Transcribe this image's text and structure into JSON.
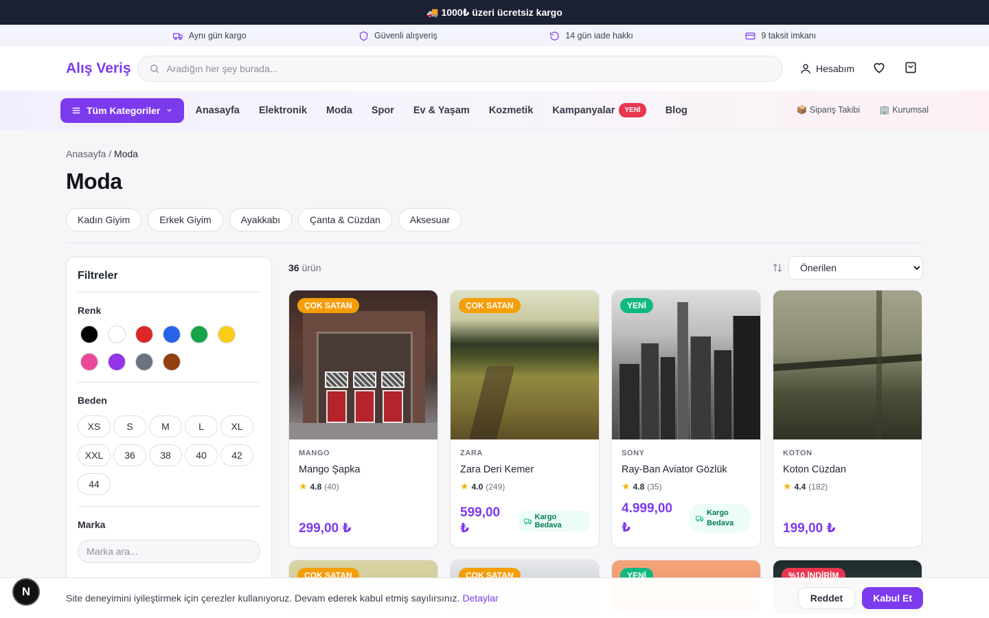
{
  "topbar": {
    "text": "🚚 1000₺ üzeri ücretsiz kargo"
  },
  "infobar": [
    {
      "icon": "truck-icon",
      "text": "Aynı gün kargo"
    },
    {
      "icon": "shield-icon",
      "text": "Güvenli alışveriş"
    },
    {
      "icon": "refresh-icon",
      "text": "14 gün iade hakkı"
    },
    {
      "icon": "credit-card-icon",
      "text": "9 taksit imkanı"
    }
  ],
  "header": {
    "logo": "Alış Veriş",
    "search_placeholder": "Aradığın her şey burada...",
    "account_label": "Hesabım"
  },
  "nav": {
    "categories_label": "Tüm Kategoriler",
    "links": [
      "Anasayfa",
      "Elektronik",
      "Moda",
      "Spor",
      "Ev & Yaşam",
      "Kozmetik",
      "Kampanyalar",
      "Blog"
    ],
    "new_badge": "YENİ",
    "right": [
      "📦 Sipariş Takibi",
      "🏢 Kurumsal"
    ]
  },
  "breadcrumb": {
    "home": "Anasayfa",
    "separator": "/",
    "current": "Moda"
  },
  "page_title": "Moda",
  "chips": [
    "Kadın Giyim",
    "Erkek Giyim",
    "Ayakkabı",
    "Çanta & Cüzdan",
    "Aksesuar"
  ],
  "filters": {
    "title": "Filtreler",
    "color_heading": "Renk",
    "colors": [
      "#000000",
      "#ffffff",
      "#dc2626",
      "#2563eb",
      "#16a34a",
      "#facc15",
      "#ec4899",
      "#9333ea",
      "#6b7280",
      "#92400e"
    ],
    "size_heading": "Beden",
    "sizes": [
      "XS",
      "S",
      "M",
      "L",
      "XL",
      "XXL",
      "36",
      "38",
      "40",
      "42",
      "44"
    ],
    "brand_heading": "Marka",
    "brand_placeholder": "Marka ara..."
  },
  "results": {
    "count": "36",
    "count_suffix": "ürün",
    "sort_selected": "Önerilen"
  },
  "products": [
    {
      "tag": "ÇOK SATAN",
      "tag_color": "#f59e0b",
      "brand": "MANGO",
      "name": "Mango Şapka",
      "rating": "4.8",
      "reviews": "(40)",
      "price": "299,00 ₺",
      "free_shipping": ""
    },
    {
      "tag": "ÇOK SATAN",
      "tag_color": "#f59e0b",
      "brand": "ZARA",
      "name": "Zara Deri Kemer",
      "rating": "4.0",
      "reviews": "(249)",
      "price": "599,00 ₺",
      "free_shipping": "Kargo Bedava"
    },
    {
      "tag": "YENİ",
      "tag_color": "#10b981",
      "brand": "SONY",
      "name": "Ray-Ban Aviator Gözlük",
      "rating": "4.8",
      "reviews": "(35)",
      "price": "4.999,00 ₺",
      "free_shipping": "Kargo Bedava"
    },
    {
      "tag": "",
      "tag_color": "",
      "brand": "KOTON",
      "name": "Koton Cüzdan",
      "rating": "4.4",
      "reviews": "(182)",
      "price": "199,00 ₺",
      "free_shipping": ""
    }
  ],
  "products_row2_tags": [
    "ÇOK SATAN",
    "ÇOK SATAN",
    "YENİ",
    "%10 İNDİRİM"
  ],
  "cookie": {
    "text": "Site deneyimini iyileştirmek için çerezler kullanıyoruz. Devam ederek kabul etmiş sayılırsınız.",
    "link": "Detaylar",
    "reject": "Reddet",
    "accept": "Kabul Et"
  },
  "dev_badge": "N"
}
